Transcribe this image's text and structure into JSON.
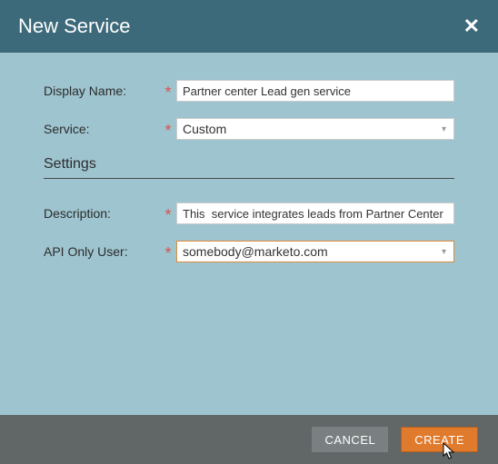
{
  "header": {
    "title": "New Service"
  },
  "form": {
    "displayName": {
      "label": "Display Name:",
      "value": "Partner center Lead gen service"
    },
    "service": {
      "label": "Service:",
      "value": "Custom"
    },
    "settingsTitle": "Settings",
    "description": {
      "label": "Description:",
      "value": "This  service integrates leads from Partner Center"
    },
    "apiUser": {
      "label": "API Only User:",
      "value": "somebody@marketo.com"
    }
  },
  "footer": {
    "cancel": "CANCEL",
    "create": "CREATE"
  }
}
